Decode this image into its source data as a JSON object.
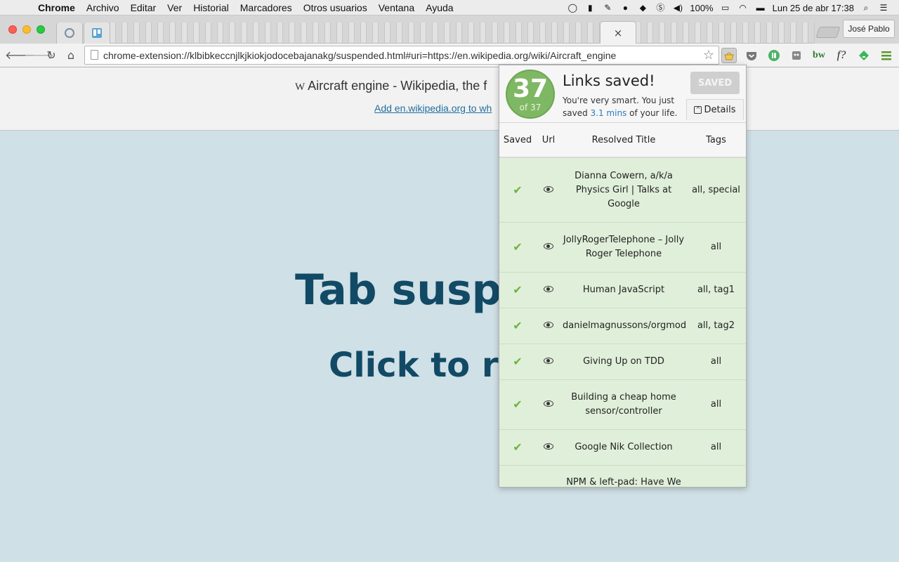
{
  "menubar": {
    "app": "Chrome",
    "items": [
      "Archivo",
      "Editar",
      "Ver",
      "Historial",
      "Marcadores",
      "Otros usuarios",
      "Ventana",
      "Ayuda"
    ],
    "battery": "100%",
    "datetime": "Lun 25 de abr  17:38"
  },
  "browser": {
    "profile": "José Pablo",
    "active_tab_close": "×",
    "url": "chrome-extension://klbibkeccnjlkjkiokjodocebajanakg/suspended.html#uri=https://en.wikipedia.org/wiki/Aircraft_engine"
  },
  "page": {
    "title_logo": "W",
    "title": "Aircraft engine - Wikipedia, the f",
    "link": "Add en.wikipedia.org to wh",
    "heading": "Tab suspe",
    "subheading": "Click to re"
  },
  "popup": {
    "count": "37",
    "of_total": "of 37",
    "title": "Links saved!",
    "subtitle_pre": "You're very smart. You just saved ",
    "subtitle_accent": "3.1 mins",
    "subtitle_post": " of your life.",
    "saved_button": "SAVED",
    "details_button": "Details",
    "columns": {
      "saved": "Saved",
      "url": "Url",
      "title": "Resolved Title",
      "tags": "Tags"
    },
    "rows": [
      {
        "title": "Dianna Cowern, a/k/a Physics Girl | Talks at Google",
        "tags": "all, special"
      },
      {
        "title": "JollyRogerTelephone – Jolly Roger Telephone",
        "tags": "all"
      },
      {
        "title": "Human JavaScript",
        "tags": "all, tag1"
      },
      {
        "title": "danielmagnussons/orgmode",
        "tags": "all, tag2"
      },
      {
        "title": "Giving Up on TDD",
        "tags": "all"
      },
      {
        "title": "Building a cheap home sensor/controller",
        "tags": "all"
      },
      {
        "title": "Google Nik Collection",
        "tags": "all"
      },
      {
        "title": "NPM & left-pad: Have We",
        "tags": ""
      }
    ]
  },
  "colors": {
    "accent": "#124a66",
    "badge": "#7fb864",
    "row_bg": "#e0efd9",
    "check": "#6db33f"
  }
}
